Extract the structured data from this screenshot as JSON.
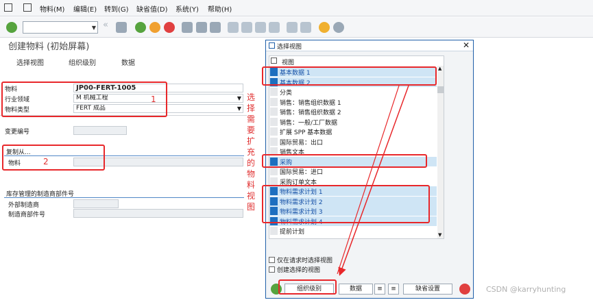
{
  "menu": {
    "items": [
      "物料(M)",
      "编辑(E)",
      "转到(G)",
      "缺省值(D)",
      "系统(Y)",
      "帮助(H)"
    ]
  },
  "screen": {
    "title": "创建物料 (初始屏幕)",
    "appbar": [
      "选择视图",
      "组织级别",
      "数据"
    ]
  },
  "form": {
    "material_label": "物料",
    "material_value": "JP00-FERT-1005",
    "industry_label": "行业领域",
    "industry_value": "M 机械工程",
    "type_label": "物料类型",
    "type_value": "FERT 成品",
    "change_no_label": "变更编号",
    "copy_from_header": "复制从...",
    "copy_material_label": "物料",
    "mpn_header": "库存管理的制造商部件号",
    "ext_manufacturer_label": "外部制造商",
    "mpn_label": "制造商部件号"
  },
  "annotations": {
    "n1": "1",
    "n2": "2",
    "vertical_note": "选择需要扩充的物料视图"
  },
  "dialog": {
    "title": "选择视图",
    "header": "视图",
    "views": [
      {
        "label": "基本数据 1",
        "selected": true
      },
      {
        "label": "基本数据 2",
        "selected": true
      },
      {
        "label": "分类",
        "selected": false
      },
      {
        "label": "销售：销售组织数据 1",
        "selected": false
      },
      {
        "label": "销售：销售组织数据 2",
        "selected": false
      },
      {
        "label": "销售：一般/工厂数据",
        "selected": false
      },
      {
        "label": "扩展 SPP 基本数据",
        "selected": false
      },
      {
        "label": "国际贸易：出口",
        "selected": false
      },
      {
        "label": "销售文本",
        "selected": false
      },
      {
        "label": "采购",
        "selected": true
      },
      {
        "label": "国际贸易：进口",
        "selected": false
      },
      {
        "label": "采购订单文本",
        "selected": false
      },
      {
        "label": "物料需求计划 1",
        "selected": true
      },
      {
        "label": "物料需求计划 2",
        "selected": true
      },
      {
        "label": "物料需求计划 3",
        "selected": true
      },
      {
        "label": "物料需求计划 4",
        "selected": true
      },
      {
        "label": "提前计划",
        "selected": false
      }
    ],
    "only_on_request": "仅在请求时选择视图",
    "create_selected": "创建选择的视图",
    "btn_org": "组织级别",
    "btn_data": "数据",
    "btn_default": "缺省设置"
  },
  "watermark": "CSDN @karryhunting"
}
